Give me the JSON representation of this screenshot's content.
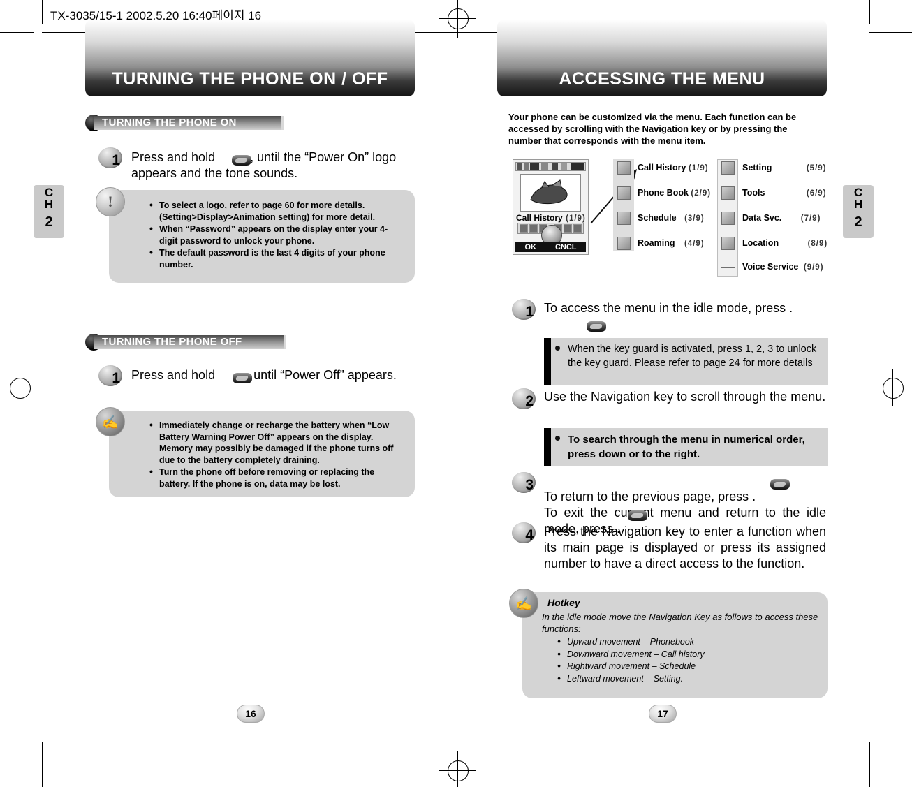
{
  "meta": {
    "filestamp": "TX-3035/15-1  2002.5.20 16:40페이지 16"
  },
  "left_page": {
    "banner_title": "TURNING THE PHONE ON / OFF",
    "ch_tab": {
      "c": "C",
      "h": "H",
      "n": "2"
    },
    "page_number": "16",
    "section_on": {
      "heading": "TURNING THE PHONE ON",
      "step_number": "1",
      "step_text": "Press and hold          , until the “Power On” logo appears and the tone sounds.",
      "note_bullets": [
        "To select a logo, refer to page 60 for more details. (Setting>Display>Animation setting) for more detail.",
        "When “Password” appears on the display enter your 4-digit password to unlock your phone.",
        "The default password is the last 4 digits of your phone number."
      ]
    },
    "section_off": {
      "heading": "TURNING THE PHONE OFF",
      "step_number": "1",
      "step_text": "Press and hold           until “Power Off” appears.",
      "note_bullets": [
        "Immediately change or recharge the battery when “Low Battery Warning Power Off” appears on the display. Memory may possibly be damaged if the phone turns off due to the battery completely draining.",
        "Turn the phone off before removing or replacing the battery. If the phone is on, data may be lost."
      ]
    }
  },
  "right_page": {
    "banner_title": "ACCESSING THE MENU",
    "ch_tab": {
      "c": "C",
      "h": "H",
      "n": "2"
    },
    "page_number": "17",
    "intro": "Your phone can be customized via the menu. Each function can be accessed by scrolling with the Navigation key or by pressing the number that corresponds with the menu item.",
    "phone_display": {
      "label": "Call History",
      "index": "(1/9)",
      "ok_label": "OK",
      "cancel_label": "CNCL"
    },
    "menu_map": {
      "column1": [
        {
          "label": "Call History",
          "index": "(1/9)"
        },
        {
          "label": "Phone Book",
          "index": "(2/9)"
        },
        {
          "label": "Schedule",
          "index": "(3/9)"
        },
        {
          "label": "Roaming",
          "index": "(4/9)"
        }
      ],
      "column2": [
        {
          "label": "Setting",
          "index": "(5/9)"
        },
        {
          "label": "Tools",
          "index": "(6/9)"
        },
        {
          "label": "Data Svc.",
          "index": "(7/9)"
        },
        {
          "label": "Location",
          "index": "(8/9)"
        },
        {
          "label": "Voice Service",
          "index": "(9/9)"
        }
      ]
    },
    "steps": [
      {
        "number": "1",
        "text": "To access the menu in the idle mode, press        ."
      },
      {
        "number": "2",
        "text": "Use the Navigation key to scroll through the menu."
      },
      {
        "number": "3",
        "text": "To return to the previous page, press        .\nTo exit the current menu and return to the idle mode, press        ."
      },
      {
        "number": "4",
        "text": "Press the Navigation key to enter a function when its main page is displayed or press its assigned number to have a direct access to the function."
      }
    ],
    "callouts": [
      "When the key guard is activated, press 1, 2, 3 to unlock the key guard. Please refer to page 24 for more details",
      "To search through the menu in numerical order, press down or to the right."
    ],
    "hotkey": {
      "title": "Hotkey",
      "lead": "In the idle mode move the Navigation Key as follows to access these functions:",
      "items": [
        "Upward movement – Phonebook",
        "Downward movement – Call history",
        "Rightward movement – Schedule",
        "Leftward movement – Setting."
      ]
    }
  }
}
